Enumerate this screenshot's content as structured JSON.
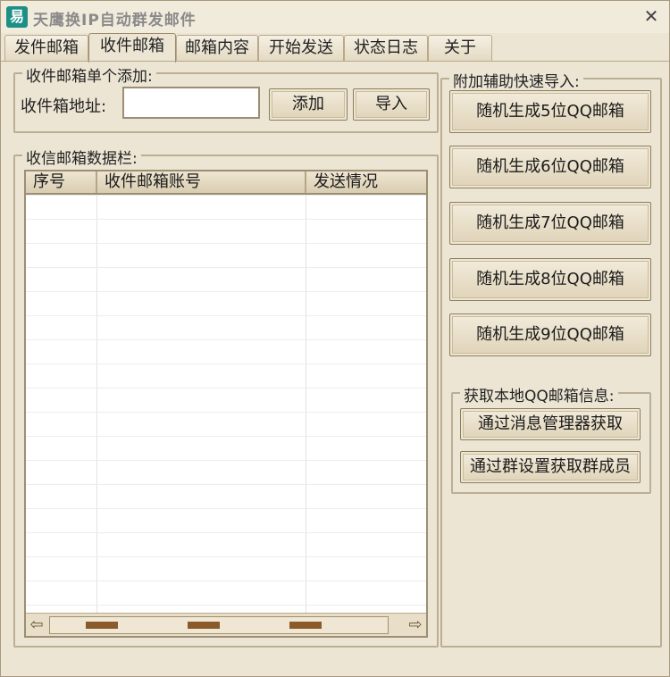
{
  "window": {
    "title": "天鹰换IP自动群发邮件",
    "icon_glyph": "易",
    "close_glyph": "✕"
  },
  "tabs": [
    {
      "label": "发件邮箱"
    },
    {
      "label": "收件邮箱",
      "active": true
    },
    {
      "label": "邮箱内容"
    },
    {
      "label": "开始发送"
    },
    {
      "label": "状态日志"
    },
    {
      "label": "关于"
    }
  ],
  "single_add": {
    "group_title": "收件邮箱单个添加:",
    "address_label": "收件箱地址:",
    "address_value": "",
    "add_label": "添加",
    "import_label": "导入"
  },
  "data_panel": {
    "group_title": "收信邮箱数据栏:",
    "columns": [
      "序号",
      "收件邮箱账号",
      "发送情况"
    ],
    "rows": []
  },
  "quick_import": {
    "group_title": "附加辅助快速导入:",
    "buttons": [
      "随机生成5位QQ邮箱",
      "随机生成6位QQ邮箱",
      "随机生成7位QQ邮箱",
      "随机生成8位QQ邮箱",
      "随机生成9位QQ邮箱"
    ]
  },
  "local_qq": {
    "group_title": "获取本地QQ邮箱信息:",
    "buttons": [
      "通过消息管理器获取",
      "通过群设置获取群成员"
    ]
  }
}
